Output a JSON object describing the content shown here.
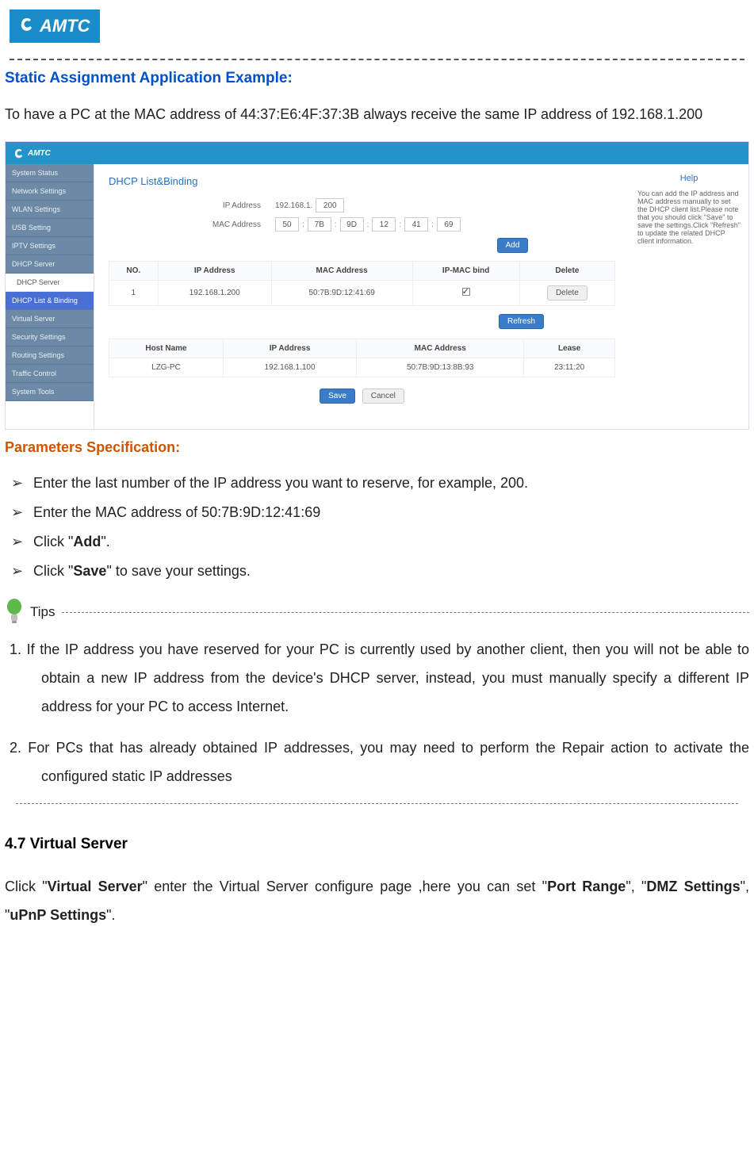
{
  "logo_text": "AMTC",
  "title_blue": "Static Assignment Application Example:",
  "intro_text": "To have a PC at the MAC address of 44:37:E6:4F:37:3B always receive the same IP address of 192.168.1.200",
  "app": {
    "topbar_logo": "AMTC",
    "sidebar": [
      {
        "label": "System Status",
        "cls": ""
      },
      {
        "label": "Network Settings",
        "cls": ""
      },
      {
        "label": "WLAN Settings",
        "cls": ""
      },
      {
        "label": "USB Setting",
        "cls": ""
      },
      {
        "label": "IPTV Settings",
        "cls": ""
      },
      {
        "label": "DHCP Server",
        "cls": ""
      },
      {
        "label": "DHCP Server",
        "cls": "sub"
      },
      {
        "label": "DHCP List & Binding",
        "cls": "active"
      },
      {
        "label": "Virtual Server",
        "cls": ""
      },
      {
        "label": "Security Settings",
        "cls": ""
      },
      {
        "label": "Routing Settings",
        "cls": ""
      },
      {
        "label": "Traffic Control",
        "cls": ""
      },
      {
        "label": "System Tools",
        "cls": ""
      }
    ],
    "panel_title": "DHCP List&Binding",
    "ip_label": "IP Address",
    "ip_prefix": "192.168.1.",
    "ip_last": "200",
    "mac_label": "MAC Address",
    "mac": [
      "50",
      "7B",
      "9D",
      "12",
      "41",
      "69"
    ],
    "add_btn": "Add",
    "binding_table": {
      "headers": [
        "NO.",
        "IP Address",
        "MAC Address",
        "IP-MAC bind",
        "Delete"
      ],
      "rows": [
        {
          "no": "1",
          "ip": "192.168.1.200",
          "mac": "50:7B:9D:12:41:69",
          "bind": true,
          "delete": "Delete"
        }
      ]
    },
    "refresh_btn": "Refresh",
    "lease_table": {
      "headers": [
        "Host Name",
        "IP Address",
        "MAC Address",
        "Lease"
      ],
      "rows": [
        {
          "host": "LZG-PC",
          "ip": "192.168.1.100",
          "mac": "50:7B:9D:13:8B:93",
          "lease": "23:11:20"
        }
      ]
    },
    "save_btn": "Save",
    "cancel_btn": "Cancel",
    "help_title": "Help",
    "help_body": "You can add the IP address and MAC address manually to set the DHCP client list.Please note that you should click \"Save\" to save the settings.Click \"Refresh\" to update the related DHCP client information."
  },
  "title_orange": "Parameters Specification:",
  "params": [
    "Enter the last number of the IP address you want to reserve, for example, 200.",
    "Enter the MAC address of 50:7B:9D:12:41:69",
    "Click \"Add\".",
    "Click \"Save\" to save your settings."
  ],
  "param_bold": {
    "2": "Add",
    "3": "Save"
  },
  "tips_label": "Tips",
  "tip1": "1. If the IP address you have reserved for your PC is currently used by another client, then you will not be able to obtain a new IP address from the device's DHCP server, instead, you must manually specify a different IP address for your PC to access Internet.",
  "tip2": "2. For PCs that has already obtained IP addresses, you may need to perform the Repair action to activate the configured static IP addresses",
  "section_47": "4.7 Virtual Server",
  "vs_text_parts": {
    "p1": "Click \"",
    "b1": "Virtual Server",
    "p2": "\" enter the Virtual Server configure page ,here you can set \"",
    "b2": "Port Range",
    "p3": "\", \"",
    "b3": "DMZ Settings",
    "p4": "\", \"",
    "b4": "uPnP Settings",
    "p5": "\"."
  }
}
